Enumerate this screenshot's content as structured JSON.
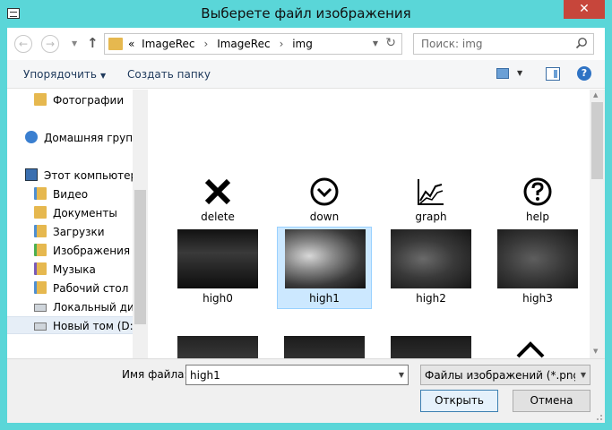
{
  "window": {
    "title": "Выберете файл изображения",
    "close_glyph": "✕"
  },
  "nav": {
    "back_icon": "back-arrow-icon",
    "forward_icon": "forward-arrow-icon",
    "up_icon": "up-arrow-icon",
    "address": {
      "prefix": "«",
      "crumbs": [
        "ImageRec",
        "ImageRec",
        "img"
      ]
    },
    "search_placeholder": "Поиск: img"
  },
  "toolbar": {
    "organize_label": "Упорядочить",
    "new_folder_label": "Создать папку",
    "help_glyph": "?"
  },
  "sidebar": {
    "items": [
      {
        "label": "Фотографии",
        "icon": "folder-icon"
      },
      {
        "label": "Домашняя группа",
        "icon": "homegroup-icon"
      },
      {
        "label": "Этот компьютер",
        "icon": "computer-icon"
      },
      {
        "label": "Видео",
        "icon": "video-folder-icon"
      },
      {
        "label": "Документы",
        "icon": "documents-folder-icon"
      },
      {
        "label": "Загрузки",
        "icon": "downloads-folder-icon"
      },
      {
        "label": "Изображения",
        "icon": "pictures-folder-icon"
      },
      {
        "label": "Музыка",
        "icon": "music-folder-icon"
      },
      {
        "label": "Рабочий стол",
        "icon": "desktop-folder-icon"
      },
      {
        "label": "Локальный диск",
        "icon": "local-disk-icon"
      },
      {
        "label": "Новый том (D:)",
        "icon": "drive-icon"
      }
    ]
  },
  "files": [
    {
      "name": "delete",
      "type": "icon",
      "icon": "x-icon"
    },
    {
      "name": "down",
      "type": "icon",
      "icon": "chevron-circle-icon"
    },
    {
      "name": "graph",
      "type": "icon",
      "icon": "graph-icon"
    },
    {
      "name": "help",
      "type": "icon",
      "icon": "question-circle-icon"
    },
    {
      "name": "high0",
      "type": "thumb"
    },
    {
      "name": "high1",
      "type": "thumb",
      "selected": true
    },
    {
      "name": "high2",
      "type": "thumb"
    },
    {
      "name": "high3",
      "type": "thumb"
    }
  ],
  "footer": {
    "filename_label": "Имя файла:",
    "filename_value": "high1",
    "filter_value": "Файлы изображений (*.png *.",
    "open_label": "Открыть",
    "cancel_label": "Отмена"
  },
  "colors": {
    "titlebar": "#5ad6d8",
    "close": "#c7463b",
    "selection": "#cce8ff"
  }
}
